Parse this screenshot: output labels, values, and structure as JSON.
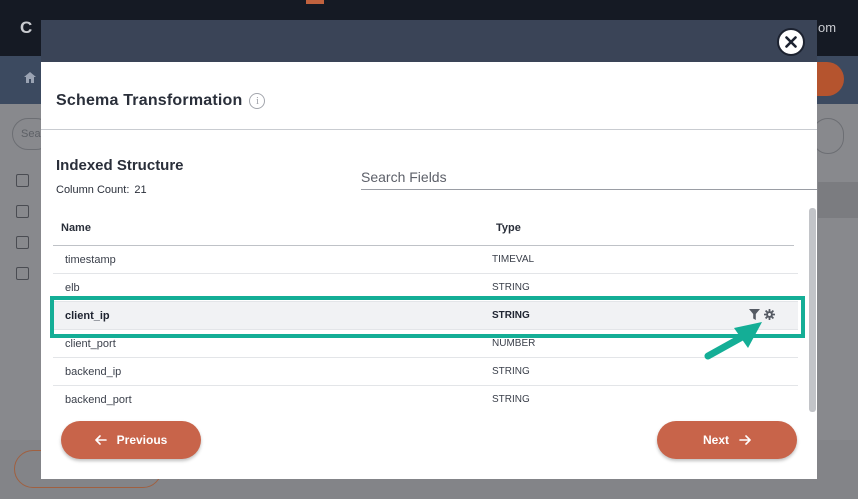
{
  "background": {
    "logo": "C H",
    "email_fragment": "om",
    "home_icon": "home-icon",
    "search_fragment": "Sea"
  },
  "modal": {
    "close_icon": "close-icon",
    "title": "Schema Transformation",
    "info_icon": "info-icon",
    "section_title": "Indexed Structure",
    "column_count_label": "Column Count:",
    "column_count": "21",
    "search_placeholder": "Search Fields",
    "table": {
      "headers": {
        "name": "Name",
        "type": "Type"
      },
      "rows": [
        {
          "name": "timestamp",
          "type": "TIMEVAL"
        },
        {
          "name": "elb",
          "type": "STRING"
        },
        {
          "name": "client_ip",
          "type": "STRING",
          "selected": true,
          "actions": [
            "filter-icon",
            "gear-icon"
          ]
        },
        {
          "name": "client_port",
          "type": "NUMBER"
        },
        {
          "name": "backend_ip",
          "type": "STRING"
        },
        {
          "name": "backend_port",
          "type": "STRING"
        }
      ]
    },
    "buttons": {
      "previous": "Previous",
      "next": "Next"
    }
  },
  "colors": {
    "accent": "#c8644a",
    "highlight": "#14ae96",
    "modal_header": "#3a4457"
  }
}
